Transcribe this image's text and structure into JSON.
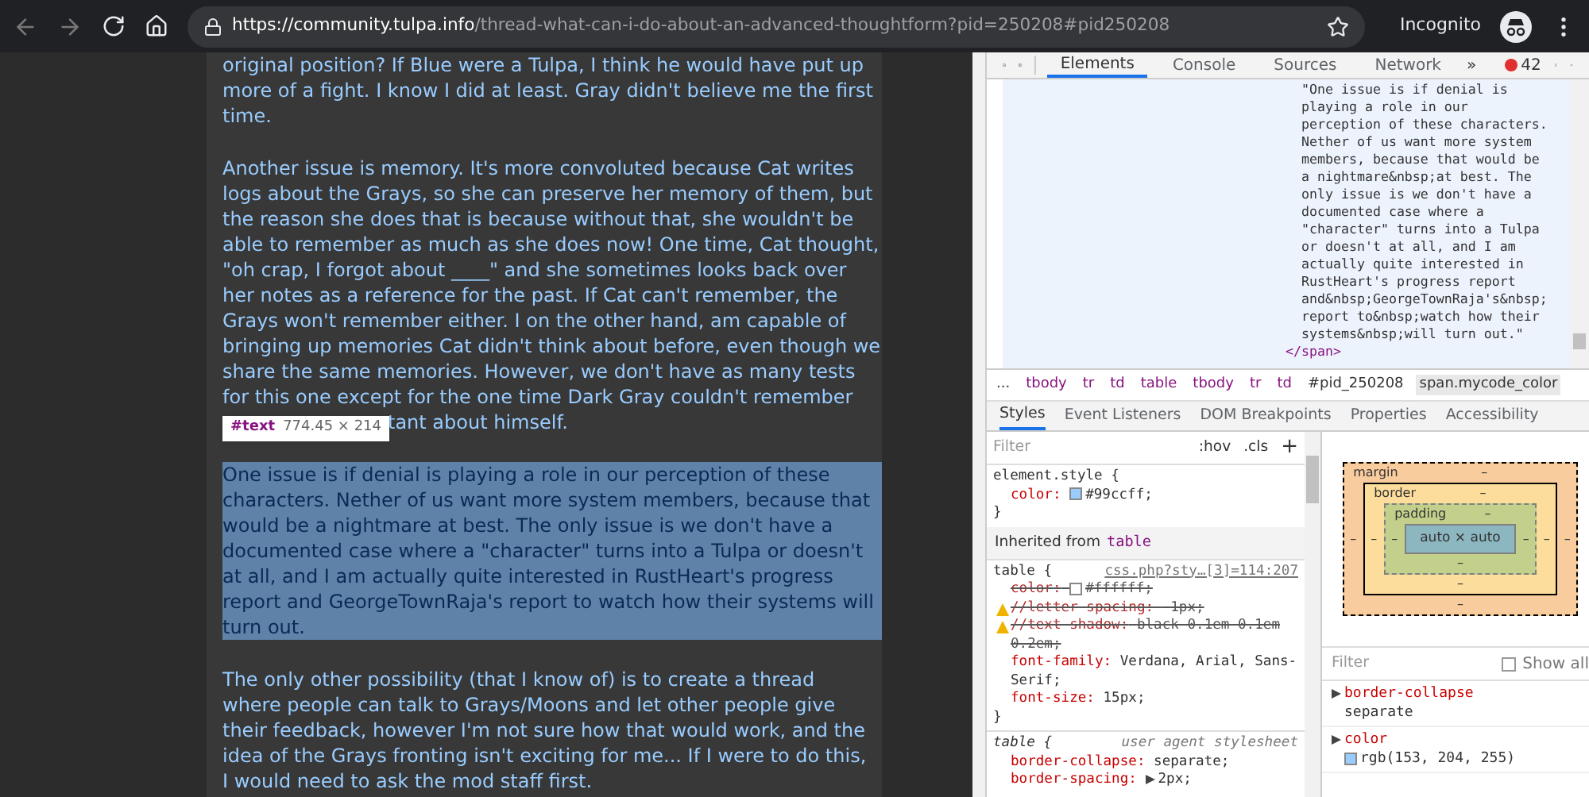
{
  "browser": {
    "url_host": "https://community.tulpa.info",
    "url_path": "/thread-what-can-i-do-about-an-advanced-thoughtform?pid=250208#pid250208",
    "profile": "Incognito"
  },
  "post": {
    "paragraphs": [
      {
        "highlighted": false,
        "lines": [
          "original position? If Blue were a Tulpa, I think he would have put up",
          "more of a fight. I know I did at least. Gray didn't believe me the first",
          "time."
        ]
      },
      {
        "highlighted": false,
        "lines": [
          "Another issue is memory. It's more convoluted because Cat writes",
          "logs about the Grays, so she can preserve her memory of them, but",
          "the reason she does that is because without that, she wouldn't be",
          "able to remember as much as she does now! One time, Cat thought,",
          "\"oh crap, I forgot about ____\" and she sometimes looks back over",
          "her notes as a reference for the past. If Cat can't remember, the",
          "Grays won't remember either. I on the other hand, am capable of",
          "bringing up memories Cat didn't think about before, even though we",
          "share the same memories. However, we don't have as many tests",
          "for this one except for the one time Dark Gray couldn't remember"
        ],
        "tail": "tant about himself."
      },
      {
        "highlighted": true,
        "lines": [
          "One issue is if denial is playing a role in our perception of these",
          "characters. Nether of us want more system members, because that",
          "would be a nightmare at best. The only issue is we don't have a",
          "documented case where a \"character\" turns into a Tulpa or doesn't",
          "at all, and I am actually quite interested in RustHeart's progress",
          "report and GeorgeTownRaja's report to watch how their systems will",
          "turn out."
        ]
      },
      {
        "highlighted": false,
        "lines": [
          "The only other possibility (that I know of) is to create a thread",
          "where people can talk to Grays/Moons and let other people give",
          "their feedback, however I'm not sure how that would work, and the",
          "idea of the Grays fronting isn't exciting for me... If I were to do this,",
          "I would need to ask the mod staff first."
        ]
      }
    ],
    "tooltip": {
      "node": "#text",
      "size": "774.45 × 214"
    }
  },
  "devtools": {
    "tabs": [
      {
        "label": "Elements",
        "selected": true
      },
      {
        "label": "Console",
        "selected": false
      },
      {
        "label": "Sources",
        "selected": false
      },
      {
        "label": "Network",
        "selected": false
      }
    ],
    "more": "»",
    "errors": "42",
    "dom_lines": [
      "\"One issue is if denial is",
      "playing a role in our",
      "perception of these characters.",
      "Nether of us want more system",
      "members, because that would be",
      "a nightmare&nbsp;at best. The",
      "only issue is we don't have a",
      "documented case where a",
      "\"character\" turns into a Tulpa",
      "or doesn't at all, and I am",
      "actually quite interested in",
      "RustHeart's progress report",
      "and&nbsp;GeorgeTownRaja's&nbsp;",
      "report to&nbsp;watch how their",
      "systems&nbsp;will turn out.\""
    ],
    "dom_close": "</span>",
    "breadcrumbs": [
      {
        "label": "...",
        "kind": "plain",
        "selected": false
      },
      {
        "label": "tbody",
        "kind": "tag",
        "selected": false
      },
      {
        "label": "tr",
        "kind": "tag",
        "selected": false
      },
      {
        "label": "td",
        "kind": "tag",
        "selected": false
      },
      {
        "label": "table",
        "kind": "tag",
        "selected": false
      },
      {
        "label": "tbody",
        "kind": "tag",
        "selected": false
      },
      {
        "label": "tr",
        "kind": "tag",
        "selected": false
      },
      {
        "label": "td",
        "kind": "tag",
        "selected": false
      },
      {
        "label": "#pid_250208",
        "kind": "plain",
        "selected": false
      },
      {
        "label": "span.mycode_color",
        "kind": "plain",
        "selected": true
      }
    ],
    "subtabs": [
      {
        "label": "Styles",
        "selected": true
      },
      {
        "label": "Event Listeners",
        "selected": false
      },
      {
        "label": "DOM Breakpoints",
        "selected": false
      },
      {
        "label": "Properties",
        "selected": false
      },
      {
        "label": "Accessibility",
        "selected": false
      }
    ],
    "styles": {
      "filter_placeholder": "Filter",
      "hov": ":hov",
      "cls": ".cls",
      "plus": "+",
      "rules": [
        {
          "selector": "element.style {",
          "italic": false,
          "decls": [
            {
              "name": "color:",
              "value": "#99ccff;",
              "color": "#99ccff",
              "struck": false
            }
          ],
          "close": "}"
        },
        {
          "selector": "table {",
          "source": "css.php?sty…[3]=114:207",
          "italic": false,
          "inherited": "table",
          "decls": [
            {
              "name": "color:",
              "value": "#ffffff;",
              "color": "#ffffff",
              "struck": true
            },
            {
              "name": "//letter-spacing:",
              "value": "-1px;",
              "struck": true,
              "warning": true
            },
            {
              "name": "//text-shadow:",
              "value": "black 0.1em 0.1em 0.2em;",
              "struck": true,
              "warning": true
            },
            {
              "name": "font-family:",
              "value": "Verdana, Arial, Sans-Serif;",
              "struck": false
            },
            {
              "name": "font-size:",
              "value": "15px;",
              "struck": false
            }
          ],
          "close": "}"
        },
        {
          "selector": "table {",
          "source": "user agent stylesheet",
          "italic": true,
          "decls": [
            {
              "name": "border-collapse:",
              "value": "separate;",
              "struck": false
            },
            {
              "name": "border-spacing:",
              "value": "2px;",
              "struck": false,
              "arrow": true
            }
          ]
        }
      ],
      "inherited_label": "Inherited from"
    },
    "box_model": {
      "margin": {
        "label": "margin",
        "top": "–",
        "right": "–",
        "bottom": "–",
        "left": "–"
      },
      "border": {
        "label": "border",
        "top": "–",
        "right": "–",
        "bottom": "–",
        "left": "–"
      },
      "padding": {
        "label": "padding",
        "top": "–",
        "right": "–",
        "bottom": "–",
        "left": "–"
      },
      "content": "auto × auto"
    },
    "computed": {
      "filter_placeholder": "Filter",
      "show_all": {
        "label": "Show all",
        "checked": false
      },
      "props": [
        {
          "name": "border-collapse",
          "value": "separate"
        },
        {
          "name": "color",
          "value": "rgb(153, 204, 255)",
          "color": "#99ccff"
        }
      ]
    }
  }
}
